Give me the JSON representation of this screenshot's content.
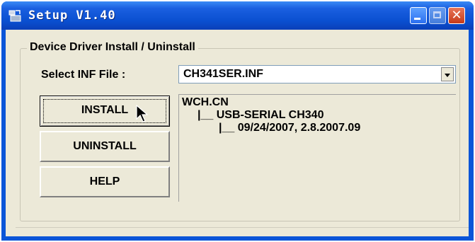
{
  "window": {
    "title": "Setup V1.40",
    "close_glyph": "✕"
  },
  "group": {
    "label": "Device Driver Install / Uninstall"
  },
  "inf": {
    "label": "Select INF File :",
    "selected": "CH341SER.INF"
  },
  "buttons": {
    "install": "INSTALL",
    "uninstall": "UNINSTALL",
    "help": "HELP"
  },
  "tree": {
    "lines": [
      "WCH.CN",
      "|__ USB-SERIAL CH340",
      "|__ 09/24/2007, 2.8.2007.09"
    ]
  },
  "colors": {
    "titlebar": "#0a4fd0",
    "client": "#ece9d8"
  },
  "icons": [
    "setup-app-icon",
    "minimize-icon",
    "maximize-icon",
    "close-icon",
    "dropdown-arrow-icon",
    "mouse-pointer-icon"
  ]
}
